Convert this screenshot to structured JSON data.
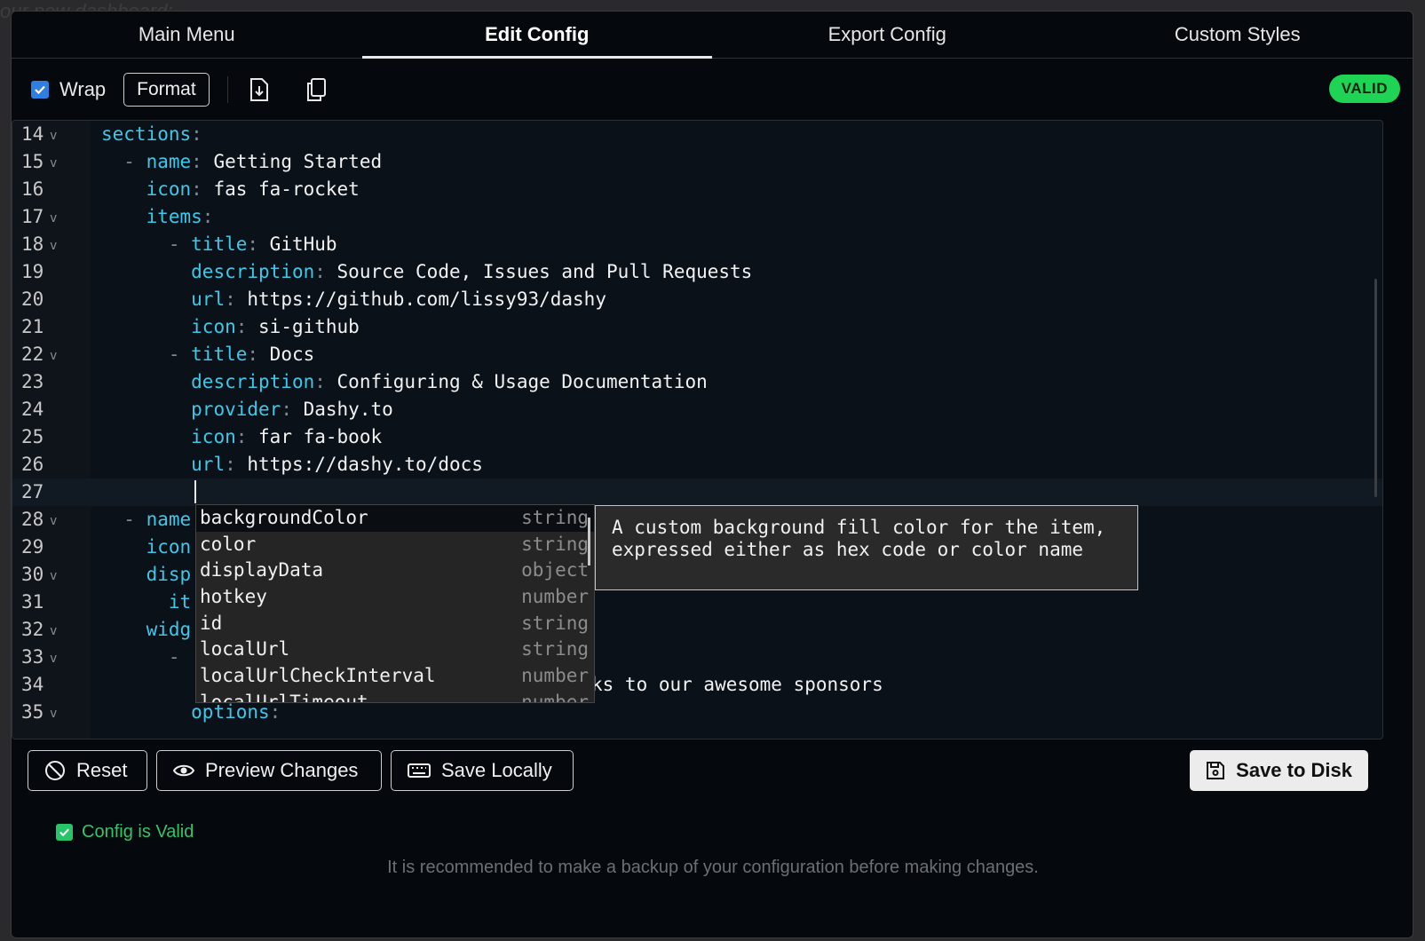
{
  "background": {
    "ghost_text": "our new dashboard:"
  },
  "tabs": [
    {
      "label": "Main Menu",
      "active": false
    },
    {
      "label": "Edit Config",
      "active": true
    },
    {
      "label": "Export Config",
      "active": false
    },
    {
      "label": "Custom Styles",
      "active": false
    }
  ],
  "toolbar": {
    "wrap_label": "Wrap",
    "wrap_checked": true,
    "format_label": "Format",
    "download_icon": "download-icon",
    "copy_icon": "copy-icon",
    "valid_badge": "VALID"
  },
  "editor": {
    "lines": [
      {
        "num": "14",
        "fold": true
      },
      {
        "num": "15",
        "fold": true
      },
      {
        "num": "16",
        "fold": false
      },
      {
        "num": "17",
        "fold": true
      },
      {
        "num": "18",
        "fold": true
      },
      {
        "num": "19",
        "fold": false
      },
      {
        "num": "20",
        "fold": false
      },
      {
        "num": "21",
        "fold": false
      },
      {
        "num": "22",
        "fold": true
      },
      {
        "num": "23",
        "fold": false
      },
      {
        "num": "24",
        "fold": false
      },
      {
        "num": "25",
        "fold": false
      },
      {
        "num": "26",
        "fold": false
      },
      {
        "num": "27",
        "fold": false
      },
      {
        "num": "28",
        "fold": true
      },
      {
        "num": "29",
        "fold": false
      },
      {
        "num": "30",
        "fold": true
      },
      {
        "num": "31",
        "fold": false
      },
      {
        "num": "32",
        "fold": true
      },
      {
        "num": "33",
        "fold": true
      },
      {
        "num": "34",
        "fold": false
      },
      {
        "num": "35",
        "fold": true
      }
    ],
    "code": {
      "l14_key": "sections",
      "l15_key": "name",
      "l15_val": "Getting Started",
      "l16_key": "icon",
      "l16_val": "fas fa-rocket",
      "l17_key": "items",
      "l18_key": "title",
      "l18_val": "GitHub",
      "l19_key": "description",
      "l19_val": "Source Code, Issues and Pull Requests",
      "l20_key": "url",
      "l20_val": "https://github.com/lissy93/dashy",
      "l21_key": "icon",
      "l21_val": "si-github",
      "l22_key": "title",
      "l22_val": "Docs",
      "l23_key": "description",
      "l23_val": "Configuring & Usage Documentation",
      "l24_key": "provider",
      "l24_val": "Dashy.to",
      "l25_key": "icon",
      "l25_val": "far fa-book",
      "l26_key": "url",
      "l26_val": "https://dashy.to/docs",
      "l28_key": "name",
      "l29_key": "icon",
      "l30_key": "disp",
      "l31_key": "it",
      "l32_key": "widg",
      "l34_val": "ks to our awesome sponsors",
      "l35_key": "options"
    },
    "autocomplete": [
      {
        "label": "backgroundColor",
        "type": "string"
      },
      {
        "label": "color",
        "type": "string"
      },
      {
        "label": "displayData",
        "type": "object"
      },
      {
        "label": "hotkey",
        "type": "number"
      },
      {
        "label": "id",
        "type": "string"
      },
      {
        "label": "localUrl",
        "type": "string"
      },
      {
        "label": "localUrlCheckInterval",
        "type": "number"
      },
      {
        "label": "localUrlTimeout",
        "type": "number"
      }
    ],
    "doc_popup": "A custom background fill color for the item, expressed either as hex code or color name"
  },
  "actions": {
    "reset": "Reset",
    "preview": "Preview Changes",
    "save_locally": "Save Locally",
    "save_disk": "Save to Disk"
  },
  "status": {
    "text": "Config is Valid",
    "note": "It is recommended to make a backup of your configuration before making changes."
  },
  "colors": {
    "accent_key": "#3ec8e8",
    "valid_green": "#1fd455",
    "checkbox_blue": "#2f7fe0",
    "background": "#05080c"
  }
}
